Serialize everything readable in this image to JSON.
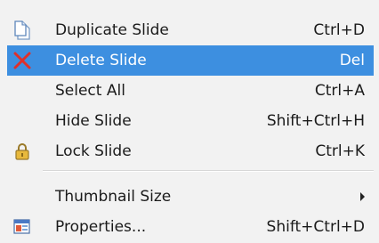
{
  "menu": {
    "items": [
      {
        "label": "Duplicate Slide",
        "shortcut": "Ctrl+D",
        "icon": "duplicate-slide-icon"
      },
      {
        "label": "Delete Slide",
        "shortcut": "Del",
        "icon": "delete-x-icon",
        "selected": true
      },
      {
        "label": "Select All",
        "shortcut": "Ctrl+A"
      },
      {
        "label": "Hide Slide",
        "shortcut": "Shift+Ctrl+H"
      },
      {
        "label": "Lock Slide",
        "shortcut": "Ctrl+K",
        "icon": "lock-icon"
      },
      {
        "label": "Thumbnail Size",
        "submenu": true,
        "icon": "submenu-arrow-icon"
      },
      {
        "label": "Properties...",
        "shortcut": "Shift+Ctrl+D",
        "icon": "properties-icon"
      }
    ]
  },
  "colors": {
    "menu_background": "#f2f2f2",
    "selection_highlight": "#3d8fe0",
    "delete_icon_red": "#e0302a",
    "text": "#1b1b1b"
  }
}
